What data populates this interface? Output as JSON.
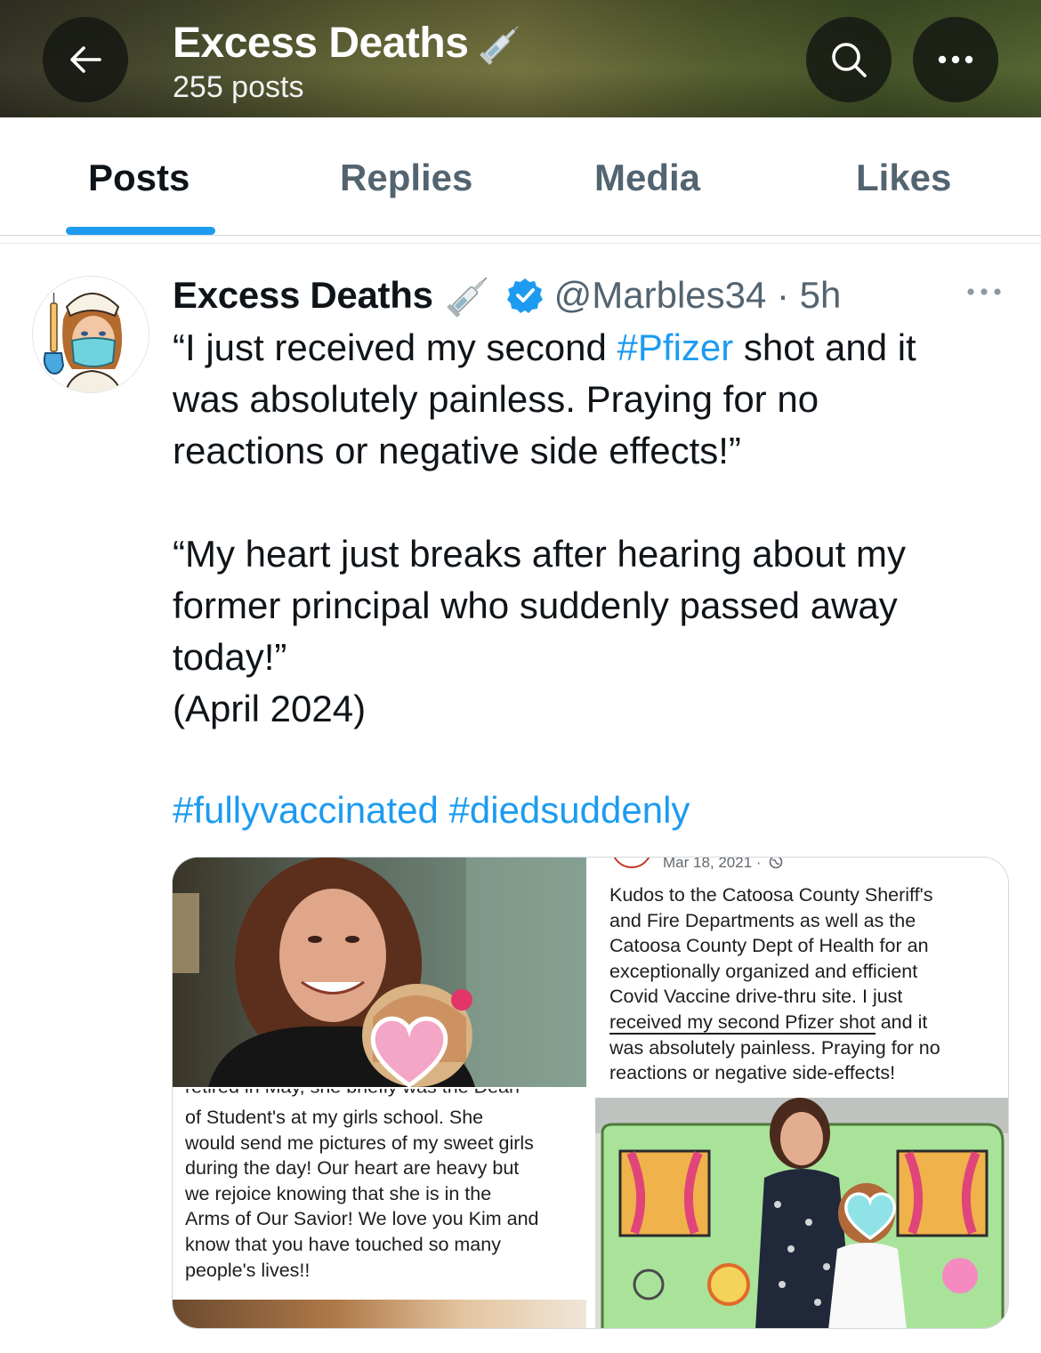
{
  "header": {
    "title": "Excess Deaths",
    "post_count": "255 posts"
  },
  "tabs": [
    {
      "label": "Posts",
      "active": true
    },
    {
      "label": "Replies",
      "active": false
    },
    {
      "label": "Media",
      "active": false
    },
    {
      "label": "Likes",
      "active": false
    }
  ],
  "post": {
    "author": "Excess Deaths",
    "handle_time": "@Marbles34 · 5h",
    "text": {
      "line1_before": "“I just received my second ",
      "line1_hashtag": "#Pfizer",
      "line1_after": " shot and it",
      "line2": "was absolutely painless. Praying for no",
      "line3": "reactions or negative side effects!”",
      "line4": "“My heart just breaks after hearing about my",
      "line5": "former principal who suddenly passed away",
      "line6": "today!”",
      "line7": "(April 2024)",
      "hashtag1": "#fullyvaccinated",
      "hashtag2": "#diedsuddenly"
    },
    "media": {
      "fb_post": {
        "date": "Mar 18, 2021 ·",
        "lines": [
          "Kudos to the Catoosa County Sheriff's",
          "and Fire Departments as well as the",
          "Catoosa County Dept of Health for an",
          "exceptionally organized and efficient",
          "Covid Vaccine drive-thru site.  I just"
        ],
        "underlined": "received my second Pfizer shot",
        "after_underline": " and it",
        "line7": "was absolutely painless.  Praying for no",
        "line8": "reactions or negative side-effects!"
      },
      "tribute": {
        "cut_line": "retired in May, she briefly was the Dean",
        "lines": [
          "of Student's at my girls school. She",
          "would send me pictures of my sweet girls",
          "during the day! Our heart are heavy but",
          "we rejoice knowing that she is in the",
          "Arms of Our Savior! We love you Kim and",
          "know that you have touched so many",
          "people's lives!!"
        ]
      }
    }
  },
  "colors": {
    "accent": "#1d9bf0",
    "secondary_text": "#536471",
    "primary_text": "#0f1419"
  },
  "icons": [
    "back-arrow-icon",
    "search-icon",
    "more-icon",
    "syringe-icon",
    "verified-badge-icon",
    "heart-icon",
    "globe-icon"
  ]
}
